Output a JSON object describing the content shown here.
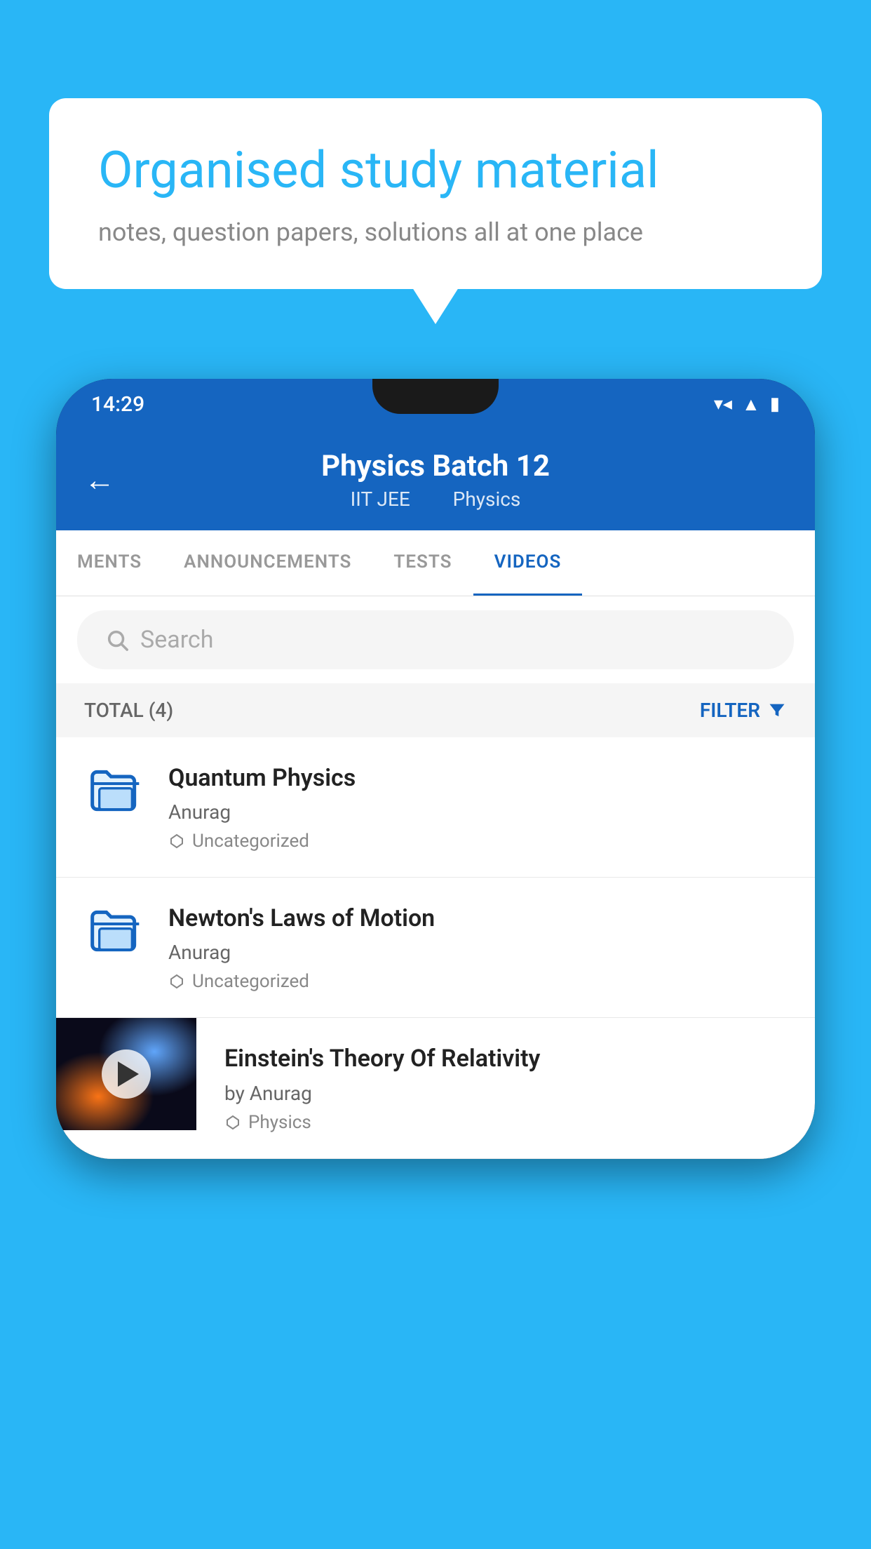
{
  "background_color": "#29b6f6",
  "speech_bubble": {
    "title": "Organised study material",
    "subtitle": "notes, question papers, solutions all at one place"
  },
  "phone": {
    "status_bar": {
      "time": "14:29"
    },
    "header": {
      "back_label": "←",
      "title": "Physics Batch 12",
      "subtitle1": "IIT JEE",
      "subtitle2": "Physics"
    },
    "tabs": [
      {
        "label": "MENTS",
        "active": false
      },
      {
        "label": "ANNOUNCEMENTS",
        "active": false
      },
      {
        "label": "TESTS",
        "active": false
      },
      {
        "label": "VIDEOS",
        "active": true
      }
    ],
    "search": {
      "placeholder": "Search"
    },
    "filter_bar": {
      "total_label": "TOTAL (4)",
      "filter_label": "FILTER"
    },
    "videos": [
      {
        "title": "Quantum Physics",
        "author": "Anurag",
        "tag": "Uncategorized",
        "has_thumbnail": false
      },
      {
        "title": "Newton's Laws of Motion",
        "author": "Anurag",
        "tag": "Uncategorized",
        "has_thumbnail": false
      },
      {
        "title": "Einstein's Theory Of Relativity",
        "author": "by Anurag",
        "tag": "Physics",
        "has_thumbnail": true
      }
    ]
  }
}
